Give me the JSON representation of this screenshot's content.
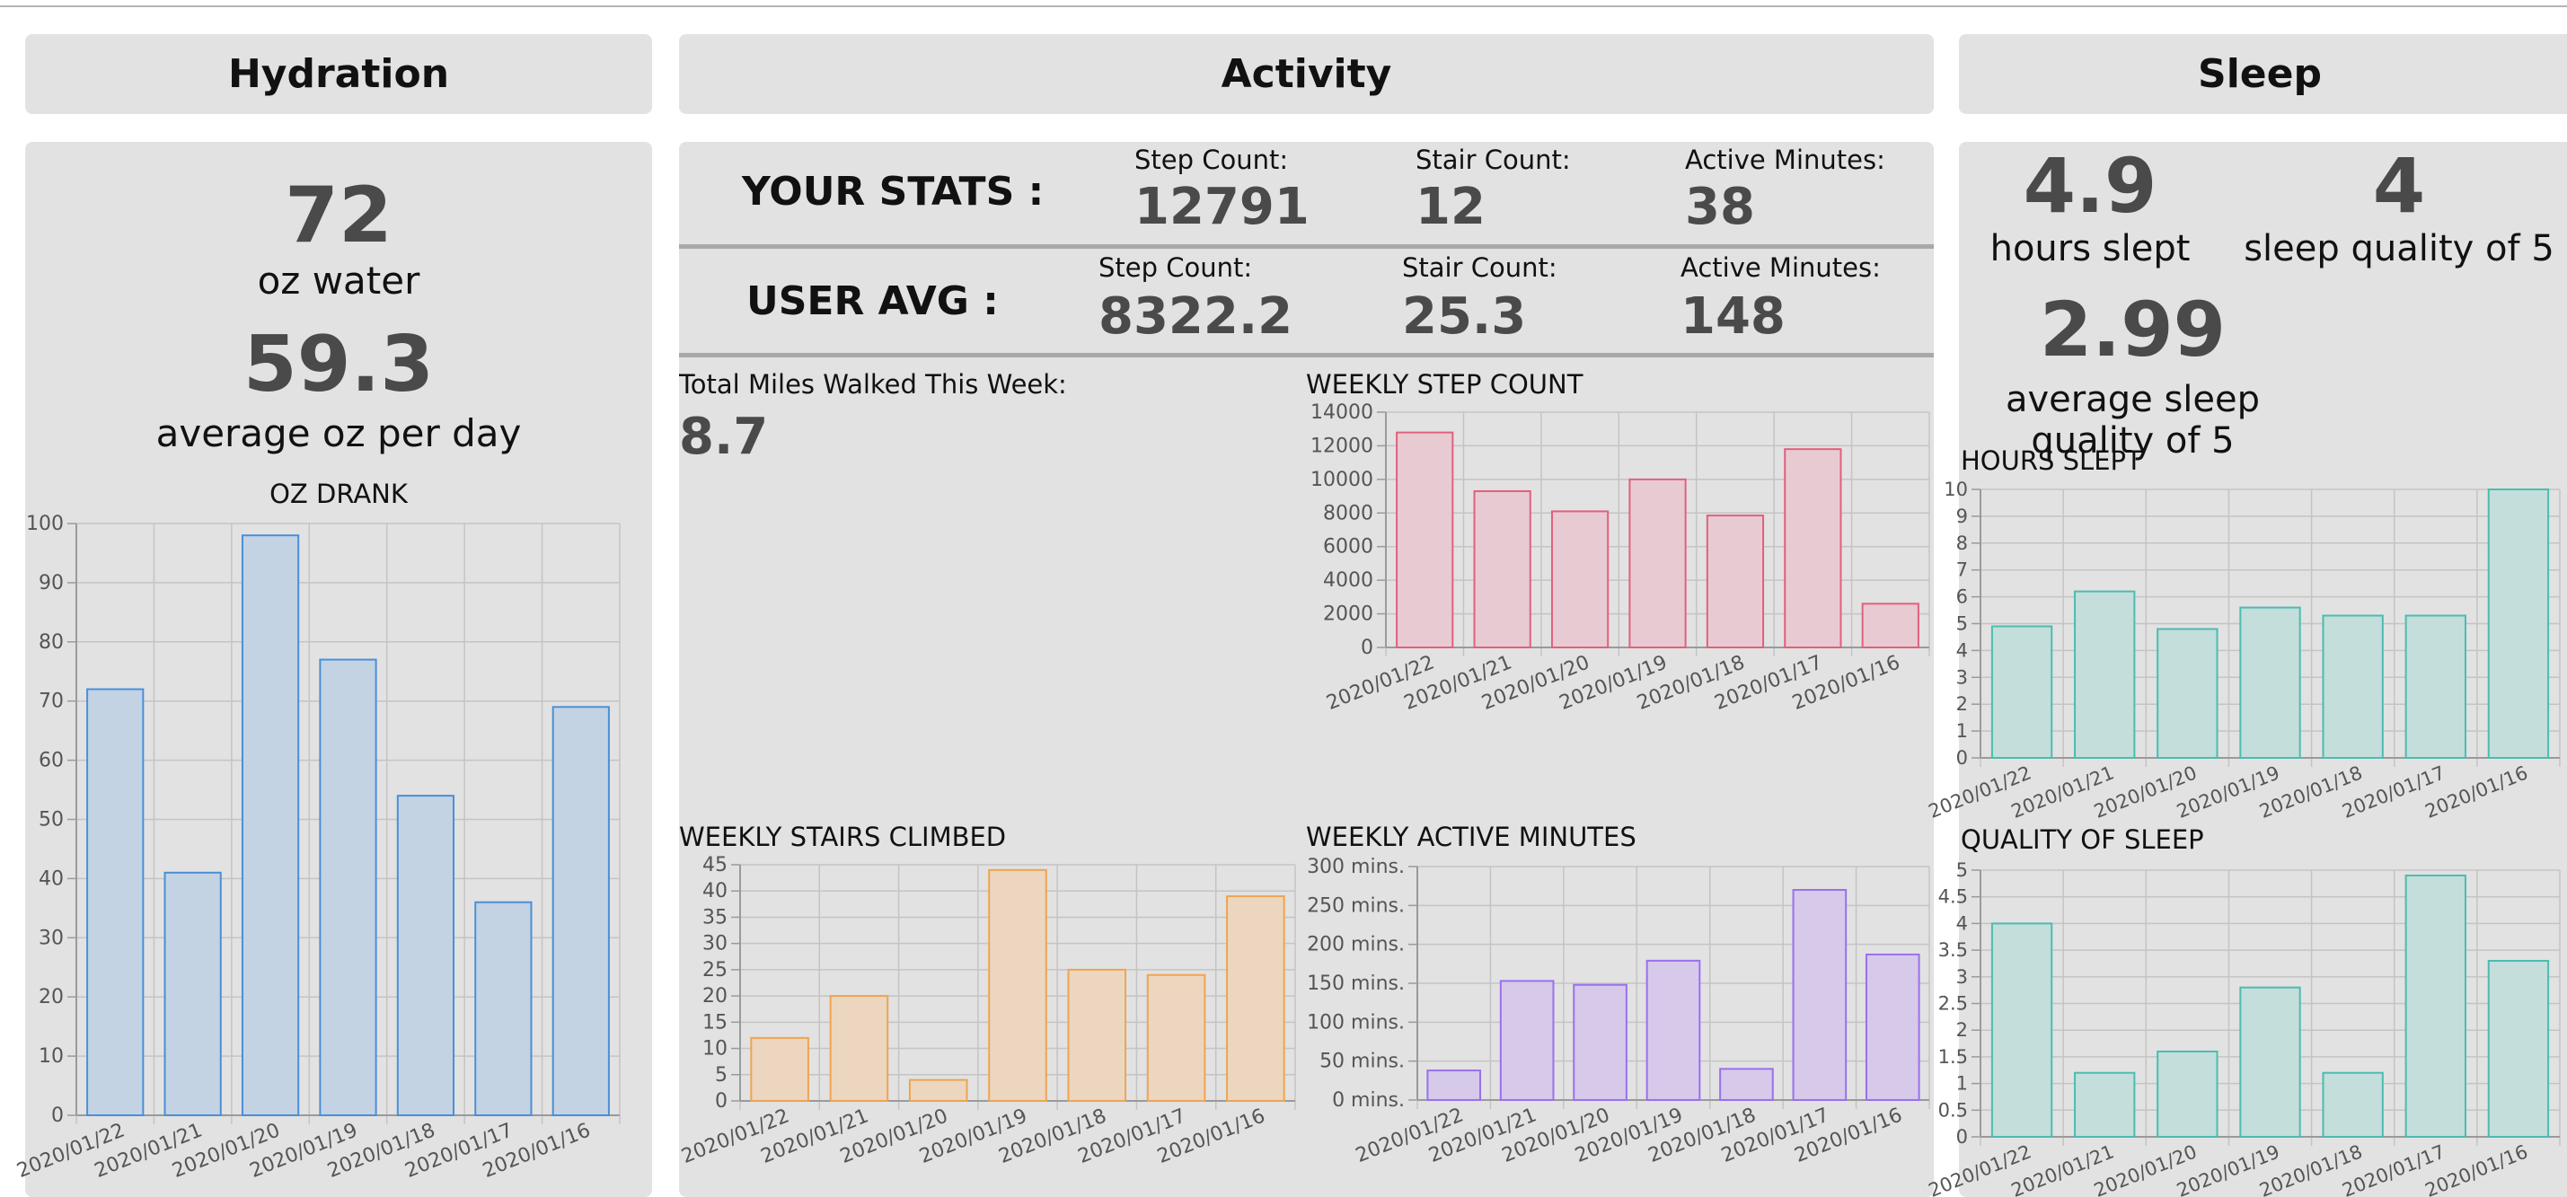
{
  "sections": {
    "hydration": "Hydration",
    "activity": "Activity",
    "sleep": "Sleep"
  },
  "hydration": {
    "today_value": "72",
    "today_unit": "oz water",
    "avg_value": "59.3",
    "avg_unit": "average oz per day"
  },
  "activity": {
    "your_stats_label": "YOUR STATS :",
    "user_avg_label": "USER AVG :",
    "step_label": "Step Count:",
    "stair_label": "Stair Count:",
    "active_label": "Active Minutes:",
    "your_steps": "12791",
    "your_stairs": "12",
    "your_active": "38",
    "avg_steps": "8322.2",
    "avg_stairs": "25.3",
    "avg_active": "148",
    "miles_label": "Total Miles Walked This Week:",
    "miles_value": "8.7"
  },
  "sleep": {
    "hours_value": "4.9",
    "hours_label": "hours slept",
    "quality_value": "4",
    "quality_label": "sleep quality of 5",
    "avg_quality_value": "2.99",
    "avg_quality_label": "average sleep quality of 5"
  },
  "colors": {
    "panel_bg": "#e2e2e2",
    "header_bg": "#e2e2e2",
    "stat_value": "#4a4a4a",
    "blue_fill": "#c3d3e3",
    "blue_stroke": "#4a8fd8",
    "pink_fill": "#e8cbd2",
    "pink_stroke": "#e0607e",
    "orange_fill": "#ecd6c0",
    "orange_stroke": "#efa450",
    "purple_fill": "#d6c9ea",
    "purple_stroke": "#9a70ee",
    "teal_fill": "#c3dedb",
    "teal_stroke": "#4cbcb0"
  },
  "chart_data": [
    {
      "id": "oz",
      "type": "bar",
      "title": "OZ DRANK",
      "categories": [
        "2020/01/22",
        "2020/01/21",
        "2020/01/20",
        "2020/01/19",
        "2020/01/18",
        "2020/01/17",
        "2020/01/16"
      ],
      "values": [
        72,
        41,
        98,
        77,
        54,
        36,
        69
      ],
      "ylim": [
        0,
        100
      ],
      "yticks": [
        0,
        10,
        20,
        30,
        40,
        50,
        60,
        70,
        80,
        90,
        100
      ],
      "ytick_labels": [
        "0",
        "10",
        "20",
        "30",
        "40",
        "50",
        "60",
        "70",
        "80",
        "90",
        "100"
      ],
      "grid": true
    },
    {
      "id": "steps",
      "type": "bar",
      "title": "WEEKLY STEP COUNT",
      "categories": [
        "2020/01/22",
        "2020/01/21",
        "2020/01/20",
        "2020/01/19",
        "2020/01/18",
        "2020/01/17",
        "2020/01/16"
      ],
      "values": [
        12791,
        9300,
        8100,
        10000,
        7850,
        11800,
        2600
      ],
      "ylim": [
        0,
        14000
      ],
      "yticks": [
        0,
        2000,
        4000,
        6000,
        8000,
        10000,
        12000,
        14000
      ],
      "ytick_labels": [
        "0",
        "2000",
        "4000",
        "6000",
        "8000",
        "10000",
        "12000",
        "14000"
      ],
      "grid": true
    },
    {
      "id": "stairs",
      "type": "bar",
      "title": "WEEKLY STAIRS CLIMBED",
      "categories": [
        "2020/01/22",
        "2020/01/21",
        "2020/01/20",
        "2020/01/19",
        "2020/01/18",
        "2020/01/17",
        "2020/01/16"
      ],
      "values": [
        12,
        20,
        4,
        44,
        25,
        24,
        39
      ],
      "ylim": [
        0,
        45
      ],
      "yticks": [
        0,
        5,
        10,
        15,
        20,
        25,
        30,
        35,
        40,
        45
      ],
      "ytick_labels": [
        "0",
        "5",
        "10",
        "15",
        "20",
        "25",
        "30",
        "35",
        "40",
        "45"
      ],
      "grid": true
    },
    {
      "id": "active",
      "type": "bar",
      "title": "WEEKLY ACTIVE MINUTES",
      "categories": [
        "2020/01/22",
        "2020/01/21",
        "2020/01/20",
        "2020/01/19",
        "2020/01/18",
        "2020/01/17",
        "2020/01/16"
      ],
      "values": [
        38,
        153,
        148,
        179,
        40,
        270,
        187
      ],
      "ylim": [
        0,
        300
      ],
      "yticks": [
        0,
        50,
        100,
        150,
        200,
        250,
        300
      ],
      "ytick_labels": [
        "0 mins.",
        "50 mins.",
        "100 mins.",
        "150 mins.",
        "200 mins.",
        "250 mins.",
        "300 mins."
      ],
      "grid": true
    },
    {
      "id": "hours",
      "type": "bar",
      "title": "HOURS SLEPT",
      "categories": [
        "2020/01/22",
        "2020/01/21",
        "2020/01/20",
        "2020/01/19",
        "2020/01/18",
        "2020/01/17",
        "2020/01/16"
      ],
      "values": [
        4.9,
        6.2,
        4.8,
        5.6,
        5.3,
        5.3,
        10
      ],
      "ylim": [
        0,
        10
      ],
      "yticks": [
        0,
        1,
        2,
        3,
        4,
        5,
        6,
        7,
        8,
        9,
        10
      ],
      "ytick_labels": [
        "0",
        "1",
        "2",
        "3",
        "4",
        "5",
        "6",
        "7",
        "8",
        "9",
        "10"
      ],
      "grid": true
    },
    {
      "id": "quality",
      "type": "bar",
      "title": "QUALITY OF SLEEP",
      "categories": [
        "2020/01/22",
        "2020/01/21",
        "2020/01/20",
        "2020/01/19",
        "2020/01/18",
        "2020/01/17",
        "2020/01/16"
      ],
      "values": [
        4,
        1.2,
        1.6,
        2.8,
        1.2,
        4.9,
        3.3
      ],
      "ylim": [
        0,
        5
      ],
      "yticks": [
        0,
        0.5,
        1,
        1.5,
        2,
        2.5,
        3,
        3.5,
        4,
        4.5,
        5
      ],
      "ytick_labels": [
        "0",
        "0.5",
        "1",
        "1.5",
        "2",
        "2.5",
        "3",
        "3.5",
        "4",
        "4.5",
        "5"
      ],
      "grid": true
    }
  ]
}
